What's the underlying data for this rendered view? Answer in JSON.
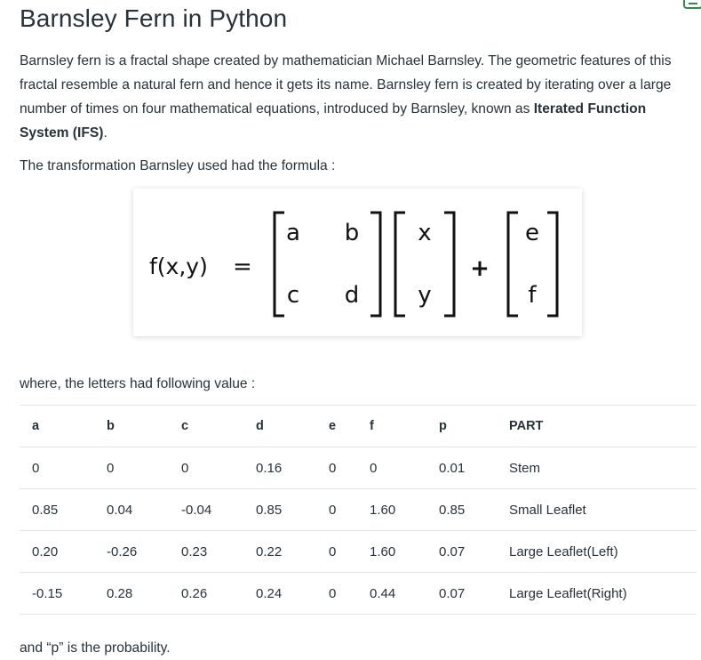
{
  "article": {
    "title": "Barnsley Fern in Python",
    "intro_part1": "Barnsley fern is a fractal shape created by mathematician Michael Barnsley. The geometric features of this fractal resemble a natural fern and hence it gets its name. Barnsley fern is created by iterating over a large number of times on four mathematical equations, introduced by Barnsley, known as ",
    "intro_bold": "Iterated Function System (IFS)",
    "intro_end": ".",
    "formula_intro": "The transformation Barnsley used had the formula :",
    "where_line": "where, the letters had following value :",
    "probability_note": "and “p” is the probability."
  },
  "formula": {
    "lhs": "f(x,y)",
    "equals": "=",
    "matrix": [
      "a",
      "b",
      "c",
      "d"
    ],
    "vector": [
      "x",
      "y"
    ],
    "plus": "+",
    "offset": [
      "e",
      "f"
    ]
  },
  "table": {
    "headers": [
      "a",
      "b",
      "c",
      "d",
      "e",
      "f",
      "p",
      "PART"
    ],
    "rows": [
      [
        "0",
        "0",
        "0",
        "0.16",
        "0",
        "0",
        "0.01",
        "Stem"
      ],
      [
        "0.85",
        "0.04",
        "-0.04",
        "0.85",
        "0",
        "1.60",
        "0.85",
        "Small Leaflet"
      ],
      [
        "0.20",
        "-0.26",
        "0.23",
        "0.22",
        "0",
        "1.60",
        "0.07",
        "Large Leaflet(Left)"
      ],
      [
        "-0.15",
        "0.28",
        "0.26",
        "0.24",
        "0",
        "0.44",
        "0.07",
        "Large Leaflet(Right)"
      ]
    ]
  },
  "colors": {
    "text": "#273239",
    "accent": "#2f8d46"
  }
}
